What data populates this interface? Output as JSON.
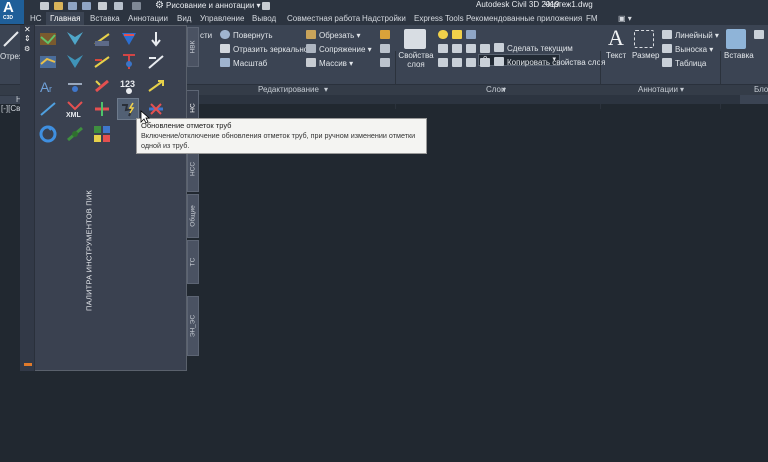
{
  "app": {
    "logo_letter": "A",
    "logo_sub": "C3D",
    "title": "Autodesk Civil 3D 2019",
    "document": "Чертеж1.dwg"
  },
  "quick_access": {
    "workspace": "Рисование и аннотации"
  },
  "tabs": [
    "НС",
    "Главная",
    "Вставка",
    "Аннотации",
    "Вид",
    "Управление",
    "Вывод",
    "Совместная работа",
    "Надстройки",
    "Express Tools",
    "Рекомендованные приложения",
    "FM"
  ],
  "active_tab": "Главная",
  "ribbon": {
    "left_cut": "Отрез",
    "edit": {
      "items": [
        "сти",
        "Повернуть",
        "Обрезать",
        "Отразить зеркально",
        "Сопряжение",
        "Масштаб",
        "Массив"
      ],
      "panel_label": "Редактирование"
    },
    "layers": {
      "properties_label": "Свойства слоя",
      "current_layer": "0",
      "make_current": "Сделать текущим",
      "copy_properties": "Копировать свойства слоя",
      "panel_label": "Слои"
    },
    "annotation": {
      "text_label": "Текст",
      "dimension_label": "Размер",
      "linear": "Линейный",
      "leader": "Выноска",
      "table": "Таблица",
      "panel_label": "Аннотации"
    },
    "block": {
      "insert_label": "Вставка",
      "panel_label": "Бло"
    }
  },
  "document_tab": {
    "label": "Н"
  },
  "viewport": {
    "label": "[-][Св"
  },
  "palette": {
    "title": "ПАЛИТРА ИНСТРУМЕНТОВ ПИК",
    "tabs": [
      "НВК",
      "НС",
      "НСС",
      "Общие",
      "ТС",
      "ЭН_ЭС"
    ],
    "active_tab": "НС"
  },
  "tooltip": {
    "title": "Обновление отметок труб",
    "description_line1": "Включение/отключение обновления отметок труб, при ручном изменении отметки",
    "description_line2": "одной из труб."
  },
  "colors": {
    "canvas": "#212830",
    "ribbon": "#3b4453",
    "accent_blue": "#1f5f99",
    "palette_marker": "#e07a2b"
  }
}
